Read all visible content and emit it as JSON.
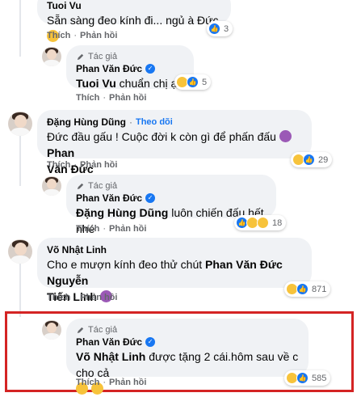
{
  "actions": {
    "like": "Thích",
    "reply": "Phản hồi",
    "sep": "·"
  },
  "author_badge": "Tác giả",
  "follow_label": "Theo dõi",
  "comments": [
    {
      "name": "Tuoi Vu",
      "text": "Sẵn sàng đeo kính đi... ngủ à Đức",
      "reaction_count": "3"
    },
    {
      "name": "Phan Văn Đức",
      "mention": "Tuoi Vu",
      "text": "chuẩn chị ạ",
      "reaction_count": "5"
    },
    {
      "name": "Đặng Hùng Dũng",
      "text_line1": "Đức đầu gấu ! Cuộc đời k còn gì để phấn đấu",
      "mention_end": "Phan",
      "mention_line2": "Văn Đức",
      "reaction_count": "29"
    },
    {
      "name": "Phan Văn Đức",
      "mention": "Đặng Hùng Dũng",
      "text": "luôn chiến đấu hết nhé",
      "reaction_count": "18"
    },
    {
      "name": "Võ Nhật Linh",
      "text_line1": "Cho e mượn kính đeo thử chút",
      "mention1": "Phan Văn Đức",
      "mention2_a": "Nguyễn",
      "mention2_b": "Tiến Linh",
      "reaction_count": "871"
    },
    {
      "name": "Phan Văn Đức",
      "mention": "Võ Nhật Linh",
      "text": "được tặng 2 cái.hôm sau về c cho cả",
      "reaction_count": "585"
    }
  ],
  "icons": {
    "verified": "verified-badge-icon",
    "author": "pen-icon",
    "haha": "haha-reaction-icon",
    "like": "like-reaction-icon",
    "devil": "smiling-devil-emoji-icon"
  },
  "colors": {
    "highlight": "#d42424",
    "link": "#1877f2",
    "bubble": "#f0f2f5"
  }
}
